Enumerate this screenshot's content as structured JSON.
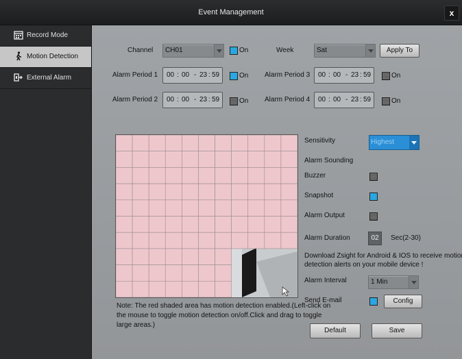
{
  "window": {
    "title": "Event Management",
    "close_label": "x"
  },
  "sidebar": {
    "items": [
      {
        "label": "Record Mode",
        "icon": "calendar-icon"
      },
      {
        "label": "Motion Detection",
        "icon": "walking-person-icon"
      },
      {
        "label": "External Alarm",
        "icon": "alarm-input-icon"
      }
    ],
    "active": "Motion Detection"
  },
  "form": {
    "channel_label": "Channel",
    "channel_value": "CH01",
    "channel_on_label": "On",
    "week_label": "Week",
    "week_value": "Sat",
    "apply_to_label": "Apply To",
    "periods": [
      {
        "label": "Alarm Period 1",
        "start_h": "00",
        "start_m": "00",
        "end_h": "23",
        "end_m": "59",
        "on_label": "On",
        "enabled": true
      },
      {
        "label": "Alarm Period 2",
        "start_h": "00",
        "start_m": "00",
        "end_h": "23",
        "end_m": "59",
        "on_label": "On",
        "enabled": false
      },
      {
        "label": "Alarm Period 3",
        "start_h": "00",
        "start_m": "00",
        "end_h": "23",
        "end_m": "59",
        "on_label": "On",
        "enabled": false
      },
      {
        "label": "Alarm Period 4",
        "start_h": "00",
        "start_m": "00",
        "end_h": "23",
        "end_m": "59",
        "on_label": "On",
        "enabled": false
      }
    ],
    "time_sep": ":",
    "time_dash": "-"
  },
  "settings": {
    "sensitivity_label": "Sensitivity",
    "sensitivity_value": "Highest",
    "alarm_sounding_label": "Alarm Sounding",
    "buzzer_label": "Buzzer",
    "buzzer_enabled": false,
    "snapshot_label": "Snapshot",
    "snapshot_enabled": true,
    "alarm_output_label": "Alarm Output",
    "alarm_output_enabled": false,
    "alarm_duration_label": "Alarm Duration",
    "alarm_duration_value": "02",
    "alarm_duration_unit": "Sec(2-30)",
    "download_note_line1": "Download Zsight for Android & IOS to receive motion",
    "download_note_line2": "detection alerts on your mobile device !",
    "alarm_interval_label": "Alarm Interval",
    "alarm_interval_value": "1 Min",
    "send_email_label": "Send E-mail",
    "send_email_enabled": true,
    "config_label": "Config"
  },
  "grid": {
    "note_line1": "Note: The red shaded area has motion detection enabled.(Left-click on",
    "note_line2": "the mouse to toggle motion detection on/off.Click and drag to toggle",
    "note_line3": "large areas.)",
    "shaded_color": "#f0c4cb",
    "cols": 11,
    "rows": 10,
    "unshaded_cells_note": "bottom-right 4x3 block disabled"
  },
  "footer": {
    "default_label": "Default",
    "save_label": "Save"
  },
  "colors": {
    "accent": "#2aa7e0",
    "panel": "#9a9ea1",
    "sidebar": "#2b2c2d",
    "active_item": "#c6c6c6"
  }
}
